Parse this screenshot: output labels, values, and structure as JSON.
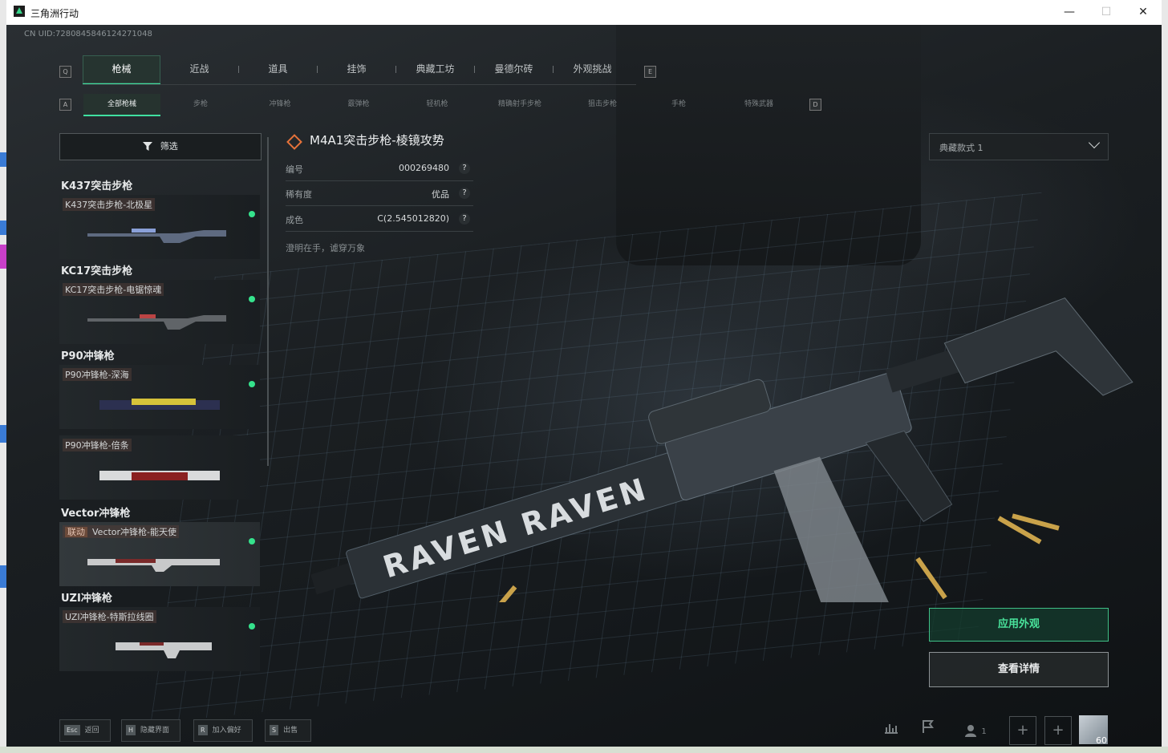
{
  "window": {
    "title": "三角洲行动",
    "minimize": "—",
    "maximize": "☐",
    "close": "✕"
  },
  "uid": "CN UID:7280845846124271048",
  "tab_keys": {
    "left": "Q",
    "right": "E"
  },
  "main_tabs": [
    {
      "label": "枪械",
      "active": true
    },
    {
      "label": "近战"
    },
    {
      "label": "道具"
    },
    {
      "label": "挂饰"
    },
    {
      "label": "典藏工坊"
    },
    {
      "label": "曼德尔砖"
    },
    {
      "label": "外观挑战"
    }
  ],
  "sub_keys": {
    "left": "A",
    "right": "D"
  },
  "sub_tabs": [
    {
      "label": "全部枪械",
      "active": true
    },
    {
      "label": "步枪"
    },
    {
      "label": "冲锋枪"
    },
    {
      "label": "霰弹枪"
    },
    {
      "label": "轻机枪"
    },
    {
      "label": "精确射手步枪"
    },
    {
      "label": "狙击步枪"
    },
    {
      "label": "手枪"
    },
    {
      "label": "特殊武器"
    }
  ],
  "filter_label": "筛选",
  "weapon_list": [
    {
      "group": "K437突击步枪",
      "skins": [
        {
          "name": "K437突击步枪-北极星",
          "equipped": true
        }
      ]
    },
    {
      "group": "KC17突击步枪",
      "skins": [
        {
          "name": "KC17突击步枪-电锯惊魂",
          "equipped": true
        }
      ]
    },
    {
      "group": "P90冲锋枪",
      "skins": [
        {
          "name": "P90冲锋枪-深海",
          "equipped": true
        },
        {
          "name": "P90冲锋枪-倍条",
          "equipped": false
        }
      ]
    },
    {
      "group": "Vector冲锋枪",
      "skins": [
        {
          "tag": "联动",
          "name": "Vector冲锋枪-能天使",
          "equipped": true,
          "selected": true
        }
      ]
    },
    {
      "group": "UZI冲锋枪",
      "skins": [
        {
          "name": "UZI冲锋枪-特斯拉线圈",
          "equipped": true
        }
      ]
    }
  ],
  "detail": {
    "title": "M4A1突击步枪-棱镜攻势",
    "rows": [
      {
        "key": "编号",
        "value": "000269480"
      },
      {
        "key": "稀有度",
        "value": "优品"
      },
      {
        "key": "成色",
        "value": "C(2.545012820)"
      }
    ],
    "help": "?",
    "motto": "澄明在手，谑穿万象"
  },
  "style_select": {
    "value": "典藏款式 1"
  },
  "apply_label": "应用外观",
  "detail_label": "查看详情",
  "weapon_decal": "RAVEN",
  "hotkeys": [
    {
      "key": "Esc",
      "label": "返回"
    },
    {
      "key": "H",
      "label": "隐藏界面"
    },
    {
      "key": "R",
      "label": "加入偏好"
    },
    {
      "key": "S",
      "label": "出售"
    }
  ],
  "bottom_right": {
    "team_count": "1",
    "level": "60"
  },
  "colors": {
    "accent": "#3fe0a0",
    "equipped_dot": "#35e28c",
    "apply_text": "#49e29b",
    "title_diamond": "#e6733a"
  },
  "icons": [
    "filter-icon",
    "stats-icon",
    "flag-icon",
    "team-icon",
    "plus-icon",
    "help-icon",
    "chevron-down-icon"
  ]
}
